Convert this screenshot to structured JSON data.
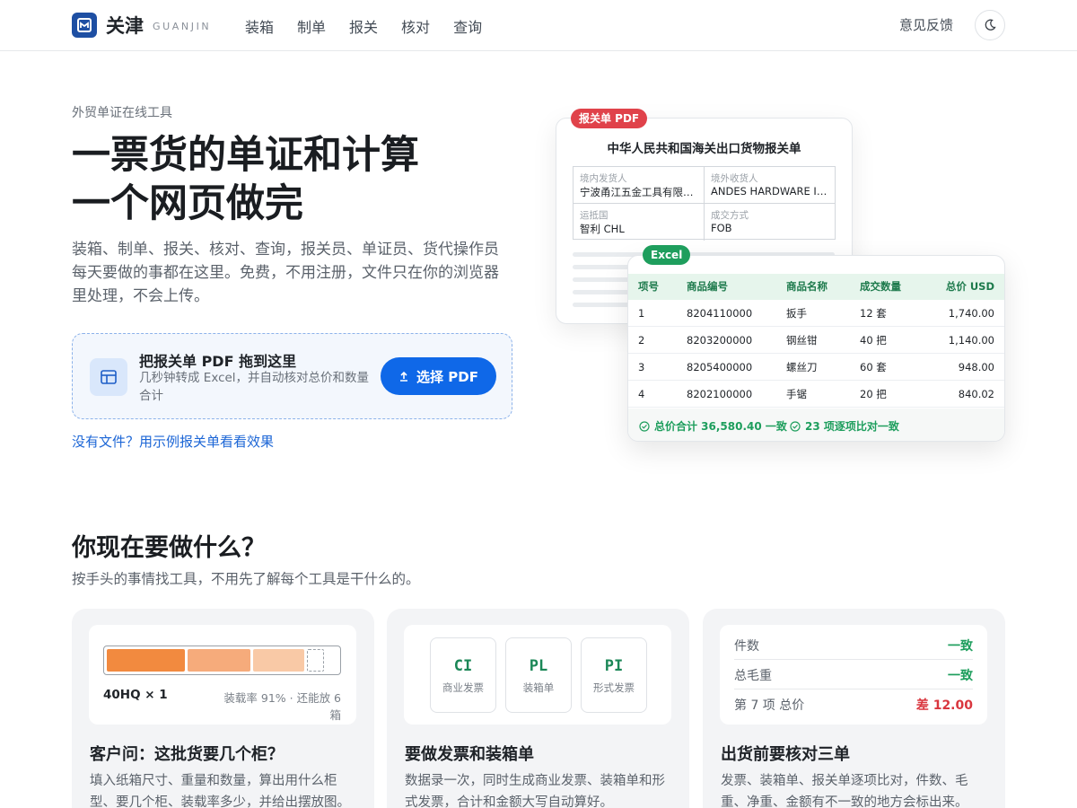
{
  "header": {
    "logo_name": "关津",
    "logo_sub": "GUANJIN",
    "nav": [
      "装箱",
      "制单",
      "报关",
      "核对",
      "查询"
    ],
    "feedback": "意见反馈"
  },
  "hero": {
    "eyebrow": "外贸单证在线工具",
    "title_line1": "一票货的单证和计算",
    "title_line2": "一个网页做完",
    "desc": "装箱、制单、报关、核对、查询，报关员、单证员、货代操作员每天要做的事都在这里。免费，不用注册，文件只在你的浏览器里处理，不会上传。",
    "drop_title": "把报关单 PDF 拖到这里",
    "drop_sub": "几秒钟转成 Excel，并自动核对总价和数量合计",
    "drop_button": "选择 PDF",
    "sample_link": "没有文件？用示例报关单看看效果"
  },
  "pdf_preview": {
    "tag": "报关单 PDF",
    "title": "中华人民共和国海关出口货物报关单",
    "cells": [
      {
        "label": "境内发货人",
        "value": "宁波甬江五金工具有限公司"
      },
      {
        "label": "境外收货人",
        "value": "ANDES HARDWARE IMPORTS"
      },
      {
        "label": "运抵国",
        "value": "智利 CHL"
      },
      {
        "label": "成交方式",
        "value": "FOB"
      }
    ]
  },
  "excel_preview": {
    "tag": "Excel",
    "headers": [
      "项号",
      "商品编号",
      "商品名称",
      "成交数量",
      "总价 USD"
    ],
    "rows": [
      [
        "1",
        "8204110000",
        "扳手",
        "12 套",
        "1,740.00"
      ],
      [
        "2",
        "8203200000",
        "钢丝钳",
        "40 把",
        "1,140.00"
      ],
      [
        "3",
        "8205400000",
        "螺丝刀",
        "60 套",
        "948.00"
      ],
      [
        "4",
        "8202100000",
        "手锯",
        "20 把",
        "840.02"
      ]
    ],
    "check_total": "总价合计 36,580.40 一致",
    "check_items": "23 项逐项比对一致"
  },
  "section": {
    "title": "你现在要做什么？",
    "subtitle": "按手头的事情找工具，不用先了解每个工具是干什么的。"
  },
  "cards": [
    {
      "title": "客户问：这批货要几个柜？",
      "desc": "填入纸箱尺寸、重量和数量，算出用什么柜型、要几个柜、装载率多少，并给出摆放图。",
      "container": "40HQ × 1",
      "meta": "装载率 91% · 还能放 6 箱",
      "load_fraction": 0.91,
      "colors": [
        "#f28a3f",
        "#f6ab7b",
        "#f9c9a6"
      ]
    },
    {
      "title": "要做发票和装箱单",
      "desc": "数据录一次，同时生成商业发票、装箱单和形式发票，合计和金额大写自动算好。",
      "docs": [
        {
          "code": "CI",
          "name": "商业发票"
        },
        {
          "code": "PL",
          "name": "装箱单"
        },
        {
          "code": "PI",
          "name": "形式发票"
        }
      ]
    },
    {
      "title": "出货前要核对三单",
      "desc": "发票、装箱单、报关单逐项比对，件数、毛重、净重、金额有不一致的地方会标出来。",
      "checks": [
        {
          "k": "件数",
          "v": "一致",
          "bad": false
        },
        {
          "k": "总毛重",
          "v": "一致",
          "bad": false
        },
        {
          "k": "第 7 项 总价",
          "v": "差 12.00",
          "bad": true
        }
      ]
    }
  ]
}
